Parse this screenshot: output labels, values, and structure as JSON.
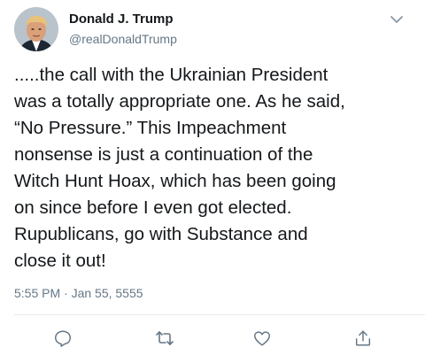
{
  "tweet": {
    "author_name": "Donald J. Trump",
    "author_handle": "@realDonaldTrump",
    "text": ".....the call with the Ukrainian President\nwas a totally appropriate one. As he said,\n“No Pressure.” This Impeachment\nnonsense is just a continuation of the\nWitch Hunt Hoax, which has been going\non since before I even got elected.\nRupublicans, go with Substance and\nclose it out!",
    "timestamp": "5:55 PM · Jan 55, 5555"
  },
  "icons": {
    "menu": "chevron-down-icon",
    "reply": "reply-icon",
    "retweet": "retweet-icon",
    "like": "like-icon",
    "share": "share-icon"
  },
  "colors": {
    "text_primary": "#14171a",
    "text_secondary": "#657786",
    "divider": "#e6ecf0"
  }
}
